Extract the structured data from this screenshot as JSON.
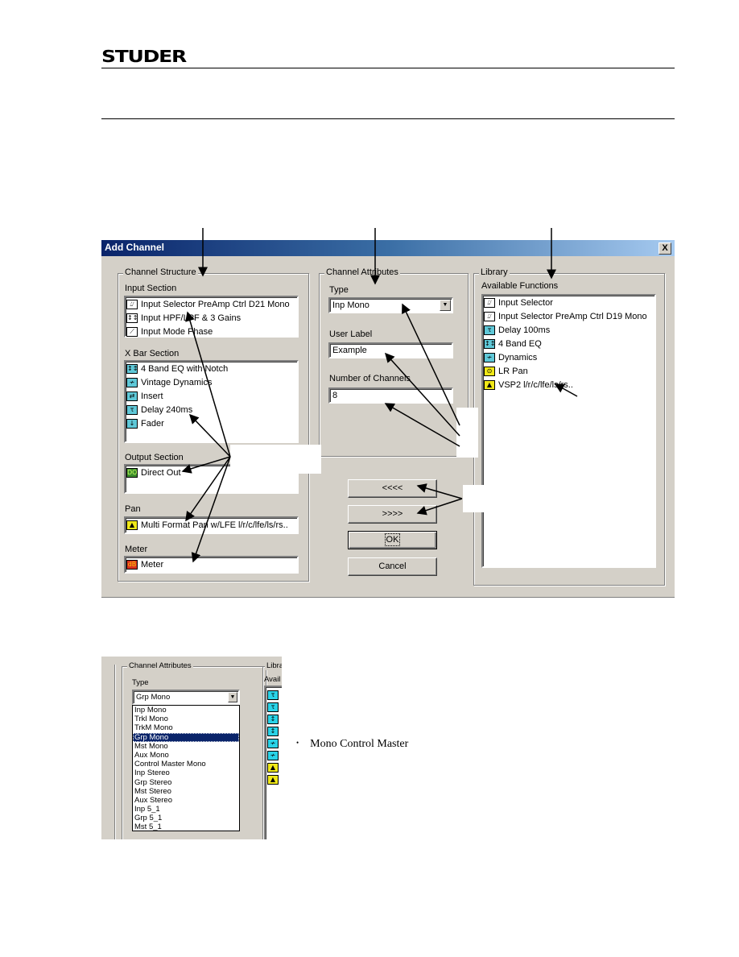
{
  "header": {
    "logo": "STUDER"
  },
  "dialog": {
    "title": "Add Channel",
    "close_label": "X",
    "channel_structure": {
      "legend": "Channel Structure",
      "input_section": {
        "label": "Input Section",
        "items": [
          {
            "icon": "input-selector-icon",
            "label": "Input Selector PreAmp Ctrl D21 Mono"
          },
          {
            "icon": "filter-gain-icon",
            "label": "Input HPF/LPF & 3 Gains"
          },
          {
            "icon": "phase-icon",
            "label": "Input Mode Phase"
          }
        ]
      },
      "xbar_section": {
        "label": "X Bar Section",
        "items": [
          {
            "icon": "eq-icon",
            "label": "4 Band EQ with Notch"
          },
          {
            "icon": "dynamics-icon",
            "label": "Vintage Dynamics"
          },
          {
            "icon": "insert-icon",
            "label": "Insert"
          },
          {
            "icon": "delay-icon",
            "label": "Delay 240ms"
          },
          {
            "icon": "fader-icon",
            "label": "Fader"
          }
        ]
      },
      "output_section": {
        "label": "Output Section",
        "items": [
          {
            "icon": "direct-out-icon",
            "label": "Direct Out"
          }
        ]
      },
      "pan": {
        "label": "Pan",
        "icon": "pan-icon",
        "value": "Multi Format Pan w/LFE l/r/c/lfe/ls/rs.."
      },
      "meter": {
        "label": "Meter",
        "icon": "meter-icon",
        "value": "Meter"
      }
    },
    "channel_attributes": {
      "legend": "Channel Attributes",
      "type_label": "Type",
      "type_value": "Inp Mono",
      "user_label_label": "User Label",
      "user_label_value": "Example",
      "num_channels_label": "Number of Channels",
      "num_channels_value": "8"
    },
    "buttons": {
      "remove": "<<<<",
      "add": ">>>>",
      "ok": "OK",
      "cancel": "Cancel"
    },
    "library": {
      "legend": "Library",
      "label": "Available Functions",
      "items": [
        {
          "icon": "input-selector-icon",
          "label": "Input Selector"
        },
        {
          "icon": "input-selector-icon",
          "label": "Input Selector PreAmp Ctrl D19 Mono"
        },
        {
          "icon": "delay-icon",
          "label": "Delay 100ms"
        },
        {
          "icon": "eq-icon",
          "label": "4 Band EQ"
        },
        {
          "icon": "dynamics-icon",
          "label": "Dynamics"
        },
        {
          "icon": "lr-pan-icon",
          "label": "LR Pan"
        },
        {
          "icon": "pan-icon",
          "label": "VSP2 l/r/c/lfe/ls/rs.."
        }
      ]
    }
  },
  "type_dropdown_crop": {
    "legend": "Channel Attributes",
    "type_label": "Type",
    "selected": "Grp Mono",
    "library_legend": "Library",
    "library_label": "Avail",
    "options": [
      "Inp Mono",
      "Trkl Mono",
      "TrkM Mono",
      "Grp Mono",
      "Mst Mono",
      "Aux Mono",
      "Control Master Mono",
      "Inp Stereo",
      "Grp Stereo",
      "Mst Stereo",
      "Aux Stereo",
      "Inp 5_1",
      "Grp 5_1",
      "Mst 5_1"
    ],
    "selected_index": 3
  },
  "body_text": {
    "bullet": "Mono Control Master"
  }
}
